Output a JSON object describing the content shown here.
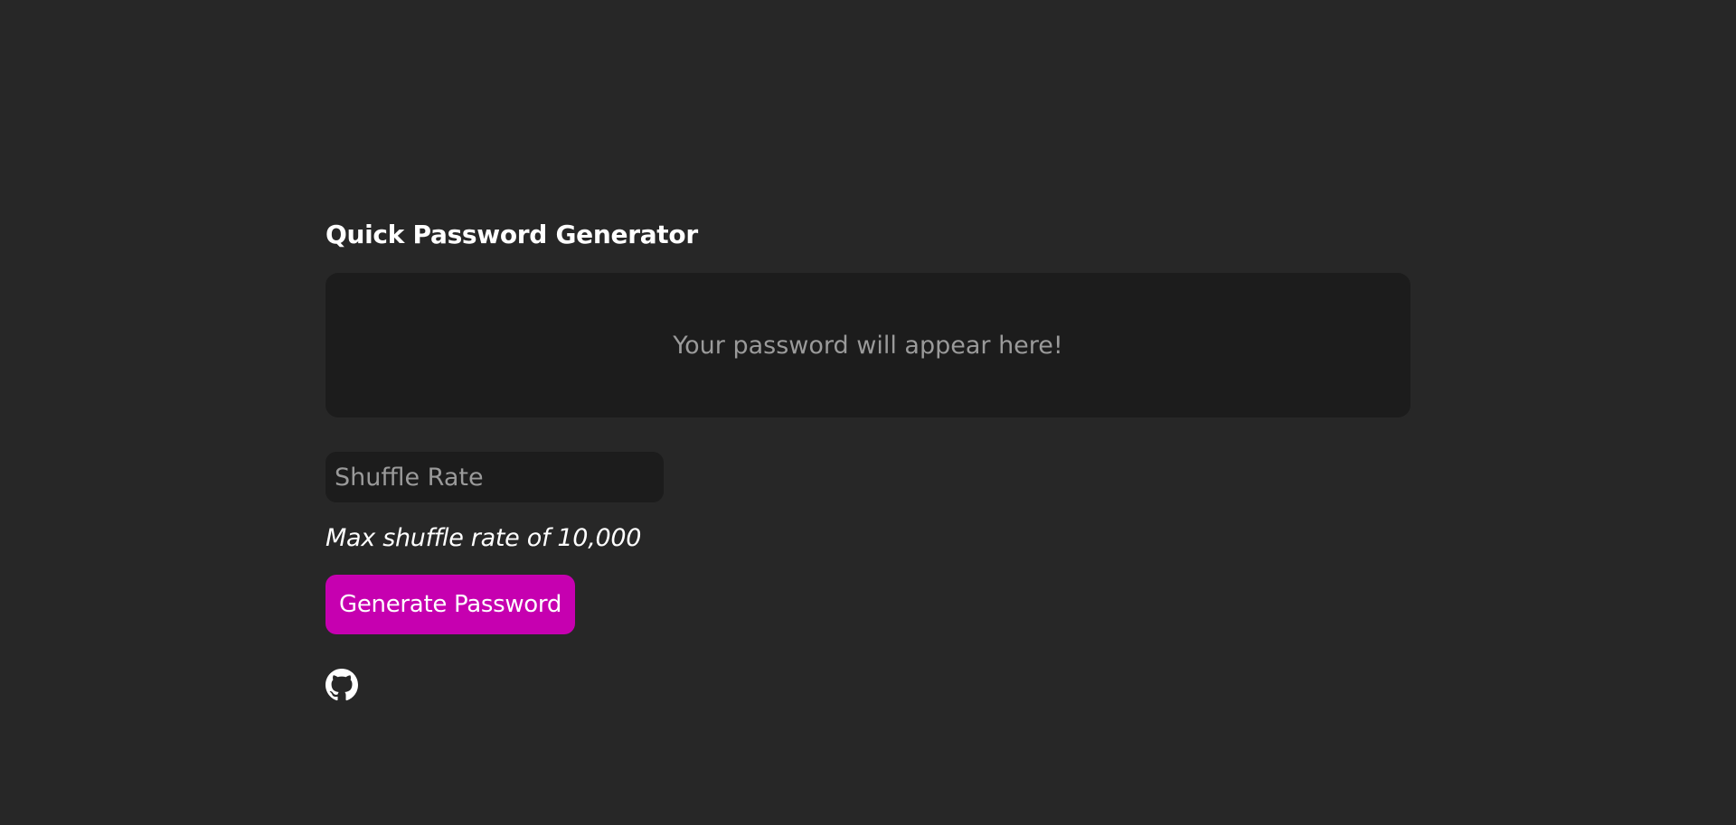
{
  "app": {
    "title": "Quick Password Generator"
  },
  "output": {
    "placeholder_text": "Your password will appear here!"
  },
  "shuffle_input": {
    "value": "",
    "placeholder": "Shuffle Rate"
  },
  "hint": {
    "text": "Max shuffle rate of 10,000"
  },
  "generate_button": {
    "label": "Generate Password"
  },
  "footer": {
    "icon": "github-icon"
  },
  "colors": {
    "background": "#272727",
    "panel": "#1c1c1c",
    "accent": "#c600b0",
    "muted_text": "#9a9a9a",
    "text": "#ffffff"
  }
}
